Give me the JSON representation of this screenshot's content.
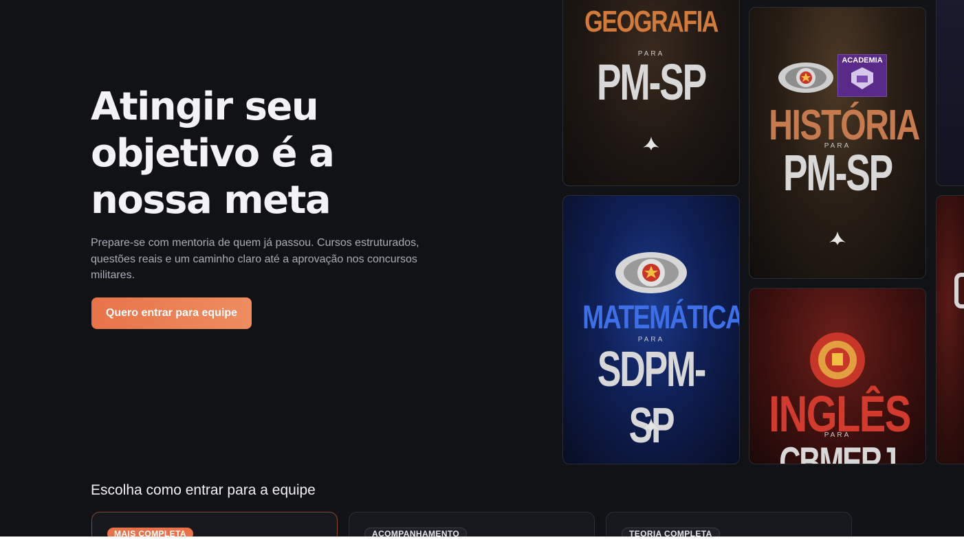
{
  "hero": {
    "title_lines": [
      "Atingir seu",
      "objetivo é a",
      "nossa meta"
    ],
    "description": "Prepare-se com mentoria de quem já passou. Cursos estruturados, questões reais e um caminho claro até a aprovação nos concursos militares.",
    "cta_label": "Quero entrar para equipe"
  },
  "cards": [
    {
      "subject": "GEOGRAFIA",
      "para": "PARA",
      "target": "PM-SP",
      "subject_color": "#d27a3a"
    },
    {
      "subject": "HISTÓRIA",
      "para": "PARA",
      "target": "PM-SP",
      "badge": "ACADEMIA",
      "subject_color": "#c77a4d"
    },
    {
      "subject": "MATEMÁTICA",
      "para": "PARA",
      "target": "SDPM-SP",
      "subject_color": "#3d6fe8"
    },
    {
      "subject": "INGLÊS",
      "para": "PARA",
      "target": "CBMERJ",
      "subject_color": "#d23a2e"
    }
  ],
  "plans": {
    "title": "Escolha como entrar para a equipe",
    "items": [
      {
        "badge": "MAIS COMPLETA"
      },
      {
        "badge": "ACOMPANHAMENTO"
      },
      {
        "badge": "TEORIA COMPLETA"
      }
    ]
  },
  "colors": {
    "background": "#111216",
    "accent": "#e8734a"
  }
}
